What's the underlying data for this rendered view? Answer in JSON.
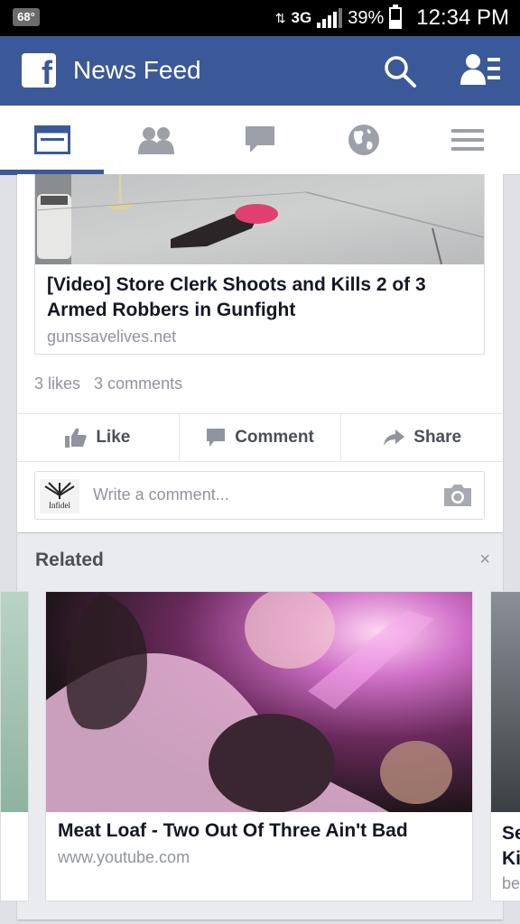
{
  "status_bar": {
    "temperature": "68°",
    "network": "3G",
    "battery": "39%",
    "time": "12:34 PM"
  },
  "header": {
    "logo": "f",
    "title": "News Feed",
    "icons": [
      "search-icon",
      "friend-requests-icon"
    ]
  },
  "tabs": [
    {
      "name": "news-feed",
      "icon": "news-feed-icon",
      "active": true
    },
    {
      "name": "friends",
      "icon": "friends-icon",
      "active": false
    },
    {
      "name": "messages",
      "icon": "messages-icon",
      "active": false
    },
    {
      "name": "notifications",
      "icon": "globe-icon",
      "active": false
    },
    {
      "name": "more",
      "icon": "menu-icon",
      "active": false
    }
  ],
  "post": {
    "link_title": "[Video] Store Clerk Shoots and Kills 2 of 3 Armed Robbers in Gunfight",
    "link_domain": "gunssavelives.net",
    "likes": "3 likes",
    "comments": "3 comments",
    "actions": {
      "like": "Like",
      "comment": "Comment",
      "share": "Share"
    },
    "comment_placeholder": "Write a comment...",
    "avatar_text": "Infidel"
  },
  "related": {
    "title": "Related",
    "close": "×",
    "items": [
      {
        "title": "Meat Loaf - Two Out Of Three Ain't Bad",
        "domain": "www.youtube.com"
      },
      {
        "title": "Se\nKi",
        "domain": "be"
      }
    ]
  },
  "colors": {
    "brand": "#3b5998",
    "muted_text": "#90949c",
    "action_text": "#4b4f56"
  }
}
